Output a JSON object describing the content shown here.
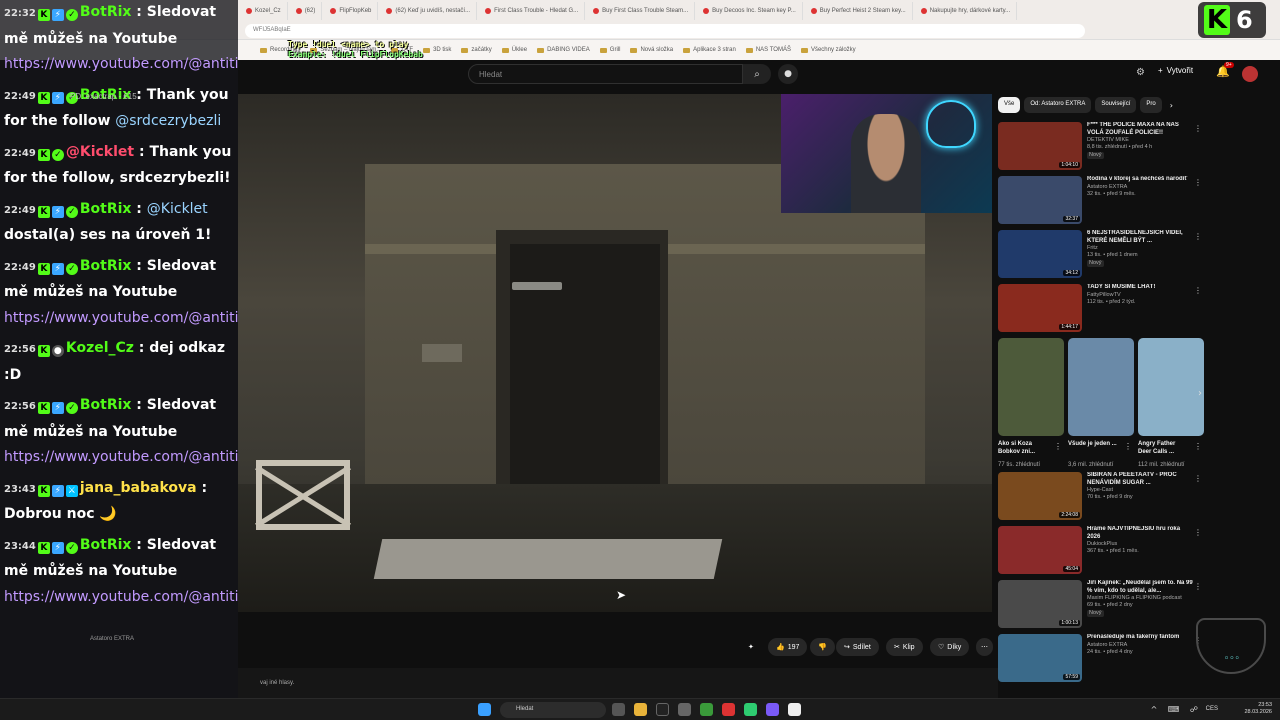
{
  "browser": {
    "tabs": [
      {
        "label": "Kozel_Cz"
      },
      {
        "label": "(62)"
      },
      {
        "label": "FlipFlopKeb"
      },
      {
        "label": "(62) Keď ju uvidíš, nestačí..."
      },
      {
        "label": "First Class Trouble - Hledat G..."
      },
      {
        "label": "Buy First Class Trouble Steam..."
      },
      {
        "label": "Buy Decoos Inc. Steam key P..."
      },
      {
        "label": "Buy Perfect Heist 2 Steam key..."
      },
      {
        "label": "Nakupujte hry, dárkové karty..."
      }
    ],
    "address": "WFIJ5ABqIaE",
    "bookmarks": [
      "Recordings",
      "Seznam – Najdu tam...",
      "DTF",
      "3D tisk",
      "začátky",
      "Úklee",
      "DABING VIDEA",
      "Grill",
      "Nová složka",
      "Aplikace 3 stran",
      "NAS TOMÁŠ",
      "Všechny záložky"
    ]
  },
  "stream_overlay": {
    "duel_line1": "Type !duel <name> to play",
    "duel_line2": "Example: !duel FlipFlopKebab",
    "kick_count": "6",
    "promo": "PD: exactrap - €15"
  },
  "youtube": {
    "search_placeholder": "Hledat",
    "create_label": "Vytvořit",
    "notif_count": "9+",
    "chips": [
      "Vše",
      "Od: Astatoro EXTRA",
      "Související",
      "Pro"
    ],
    "actions": {
      "likes": "197",
      "share": "Sdílet",
      "clip": "Klip",
      "thanks": "Díky"
    },
    "caption_hint": "vaj iné hlasy.",
    "recommendations": [
      {
        "title": "F*** THE POLICE MAXA NA NÁS VOLÁ ZOUFALÉ POLICIE!!",
        "channel": "DETEKTIV MIKE",
        "meta": "8,8 tis. zhlédnutí • před 4 h",
        "badge": "Nový",
        "duration": "1:04:10",
        "color": "#7a2b20"
      },
      {
        "title": "Rodina v ktorej sa nechceš narodiť",
        "channel": "Astatoro EXTRA",
        "meta": "32 tis. • před 9 měs.",
        "badge": "",
        "duration": "32:37",
        "color": "#3a4a6a"
      },
      {
        "title": "6 NEJSTRAŠIDELNĚJŠÍCH VIDEÍ, KTERÉ NEMĚLI BÝT ...",
        "channel": "Fritz",
        "meta": "13 tis. • před 1 dnem",
        "badge": "Nový",
        "duration": "34:12",
        "color": "#203a6a"
      },
      {
        "title": "TADY SI MUSÍME LHÁT!",
        "channel": "FattyPillowTV",
        "meta": "112 tis. • před 2 týd.",
        "badge": "",
        "duration": "1:44:17",
        "color": "#8a2a1e"
      }
    ],
    "shorts": [
      {
        "title": "Ako si Koza Bobkov zni...",
        "views": "77 tis. zhlédnutí",
        "color": "#4d5a3a"
      },
      {
        "title": "Všude je jeden ...",
        "views": "3,6 mil. zhlédnutí",
        "color": "#6a8aa8"
      },
      {
        "title": "Angry Father Deer Calls ...",
        "views": "112 mil. zhlédnutí",
        "color": "#8ab0c8"
      }
    ],
    "recommendations2": [
      {
        "title": "SIBIŘAN A PEEETAATV - PROČ NENÁVIDÍM SUGAR ...",
        "channel": "Hype-Cast",
        "meta": "70 tis. • před 9 dny",
        "badge": "",
        "duration": "2:24:08",
        "color": "#7a4a1e"
      },
      {
        "title": "Hráme NAJVTIPNEJŠIU hru roka 2026",
        "channel": "DukiockPlus",
        "meta": "367 tis. • před 1 měs.",
        "badge": "",
        "duration": "45:04",
        "color": "#8a2a2a"
      },
      {
        "title": "Jiří Kajínek: „Neudělal jsem to. Na 99 % vím, kdo to udělal, ale...",
        "channel": "Maxim FLIPKING a FLIPKING podcast",
        "meta": "69 tis. • před 2 dny",
        "badge": "Nový",
        "duration": "1:00:13",
        "color": "#4a4a4a"
      },
      {
        "title": "Prenasleduje ma fakeľný fantom",
        "channel": "Astatoro EXTRA",
        "meta": "24 tis. • před 4 dny",
        "badge": "",
        "duration": "57:59",
        "color": "#3a6a8a"
      }
    ]
  },
  "chat": {
    "messages": [
      {
        "time": "22:32",
        "badges": [
          "kick",
          "bot",
          "ver"
        ],
        "user": "BotRix",
        "color": "#53fc18",
        "text": "Sledovat mě můžeš na Youtube",
        "link": "https://www.youtube.com/@antitiktokercz"
      },
      {
        "time": "22:49",
        "badges": [
          "kick",
          "bot",
          "ver"
        ],
        "user": "BotRix",
        "color": "#53fc18",
        "text": "Thank you for the follow",
        "mention": "@srdcezrybezli"
      },
      {
        "time": "22:49",
        "badges": [
          "kick",
          "ver"
        ],
        "user": "@Kicklet",
        "color": "#ff4d6d",
        "text": "Thank you for the follow, srdcezrybezli!"
      },
      {
        "time": "22:49",
        "badges": [
          "kick",
          "bot",
          "ver"
        ],
        "user": "BotRix",
        "color": "#53fc18",
        "mention_first": "@Kicklet",
        "text": "dostal(a) ses na úroveň 1!"
      },
      {
        "time": "22:49",
        "badges": [
          "kick",
          "bot",
          "ver"
        ],
        "user": "BotRix",
        "color": "#53fc18",
        "text": "Sledovat mě můžeš na Youtube",
        "link": "https://www.youtube.com/@antitiktokercz"
      },
      {
        "time": "22:56",
        "badges": [
          "kick",
          "og"
        ],
        "user": "Kozel_Cz",
        "color": "#53fc18",
        "text": "dej odkaz :D"
      },
      {
        "time": "22:56",
        "badges": [
          "kick",
          "bot",
          "ver"
        ],
        "user": "BotRix",
        "color": "#53fc18",
        "text": "Sledovat mě můžeš na Youtube",
        "link": "https://www.youtube.com/@antitiktokercz"
      },
      {
        "time": "23:43",
        "badges": [
          "kick",
          "bot",
          "mod"
        ],
        "user": "jana_babakova",
        "color": "#ffe14a",
        "text": "Dobrou noc 🌙"
      },
      {
        "time": "23:44",
        "badges": [
          "kick",
          "bot",
          "ver"
        ],
        "user": "BotRix",
        "color": "#53fc18",
        "text": "Sledovat mě můžeš na Youtube",
        "link": "https://www.youtube.com/@antitiktokercz"
      }
    ],
    "under_channel": "Astatoro EXTRA"
  },
  "taskbar": {
    "search": "Hledat",
    "lang": "CES",
    "time": "23:53",
    "date": "28.03.2026"
  }
}
